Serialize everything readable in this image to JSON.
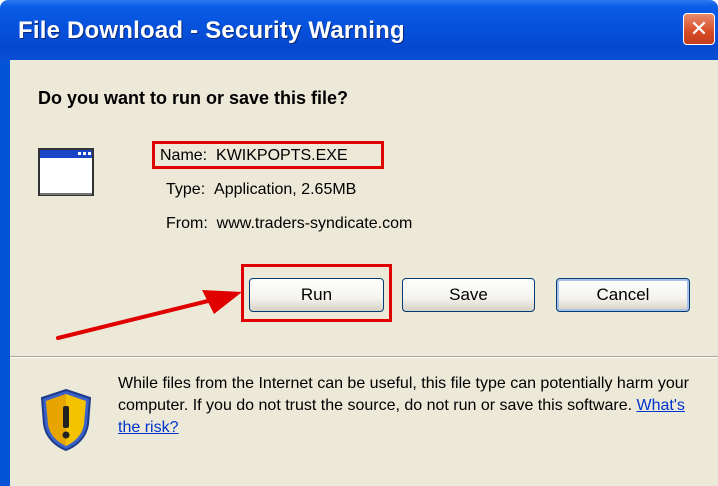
{
  "window": {
    "title": "File Download - Security Warning",
    "close_icon": "close-icon"
  },
  "dialog": {
    "question": "Do you want to run or save this file?",
    "file_icon": "application-window-icon",
    "name_label": "Name:",
    "name_value": "KWIKPOPTS.EXE",
    "type_label": "Type:",
    "type_value": "Application, 2.65MB",
    "from_label": "From:",
    "from_value": "www.traders-syndicate.com"
  },
  "buttons": {
    "run": "Run",
    "save": "Save",
    "cancel": "Cancel"
  },
  "warning": {
    "icon": "shield-warning-icon",
    "text": "While files from the Internet can be useful, this file type can potentially harm your computer. If you do not trust the source, do not run or save this software.",
    "link": "What's the risk?"
  },
  "annotations": {
    "highlight_color": "#e00000",
    "arrow_color": "#e00000"
  }
}
